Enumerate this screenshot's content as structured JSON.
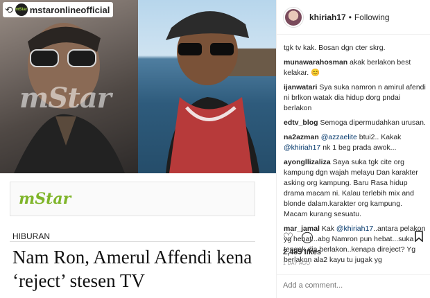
{
  "repost": {
    "handle": "mstaronlineofficial",
    "logo_text": "mStar",
    "repost_icon": "repost-icon"
  },
  "image": {
    "watermark": "mStar",
    "brand_logo": "mStar",
    "section": "HIBURAN",
    "headline": "Nam Ron, Amerul Affendi kena ‘reject’ stesen TV"
  },
  "header": {
    "username": "khiriah17",
    "separator": "•",
    "follow": "Following"
  },
  "comments": [
    {
      "user": "",
      "parts": [
        {
          "t": "tgk tv kak. Bosan dgn cter skrg."
        }
      ]
    },
    {
      "user": "munawarahosman",
      "parts": [
        {
          "t": " akak berlakon best kelakar. 😊"
        }
      ]
    },
    {
      "user": "ijanwatari",
      "parts": [
        {
          "t": " Sya suka namron n amirul afendi ni brlkon watak dia hidup dorg pndai berlakon"
        }
      ]
    },
    {
      "user": "edtv_blog",
      "parts": [
        {
          "t": " Semoga dipermudahkan urusan."
        }
      ]
    },
    {
      "user": "na2azman",
      "parts": [
        {
          "t": " "
        },
        {
          "t": "@azzaelite",
          "m": true
        },
        {
          "t": " btui2.. Kakak "
        },
        {
          "t": "@khiriah17",
          "m": true
        },
        {
          "t": " nk 1 beg prada awok..."
        }
      ]
    },
    {
      "user": "ayongllizaliza",
      "parts": [
        {
          "t": " Saya suka tgk cite org kampung dgn wajah melayu Dan karakter asking org kampung. Baru Rasa hidup drama macam ni. Kalau terlebih mix and blonde dalam.karakter org kampung. Macam kurang sesuatu."
        }
      ]
    },
    {
      "user": "mar_jamal",
      "parts": [
        {
          "t": " Kak "
        },
        {
          "t": "@khiriah17",
          "m": true
        },
        {
          "t": "..antara pelakon yg hebat...abg Namron pun hebat...suka tengok dia berlakon..kenapa direject? Yg berlakon ala2 kayu tu jugak yg"
        }
      ]
    }
  ],
  "actions": {
    "like": "heart-icon",
    "comment": "comment-icon",
    "save": "bookmark-icon"
  },
  "likes": "2,489 likes",
  "timestamp": "1 DAY AGO",
  "comment_input": {
    "placeholder": "Add a comment..."
  }
}
